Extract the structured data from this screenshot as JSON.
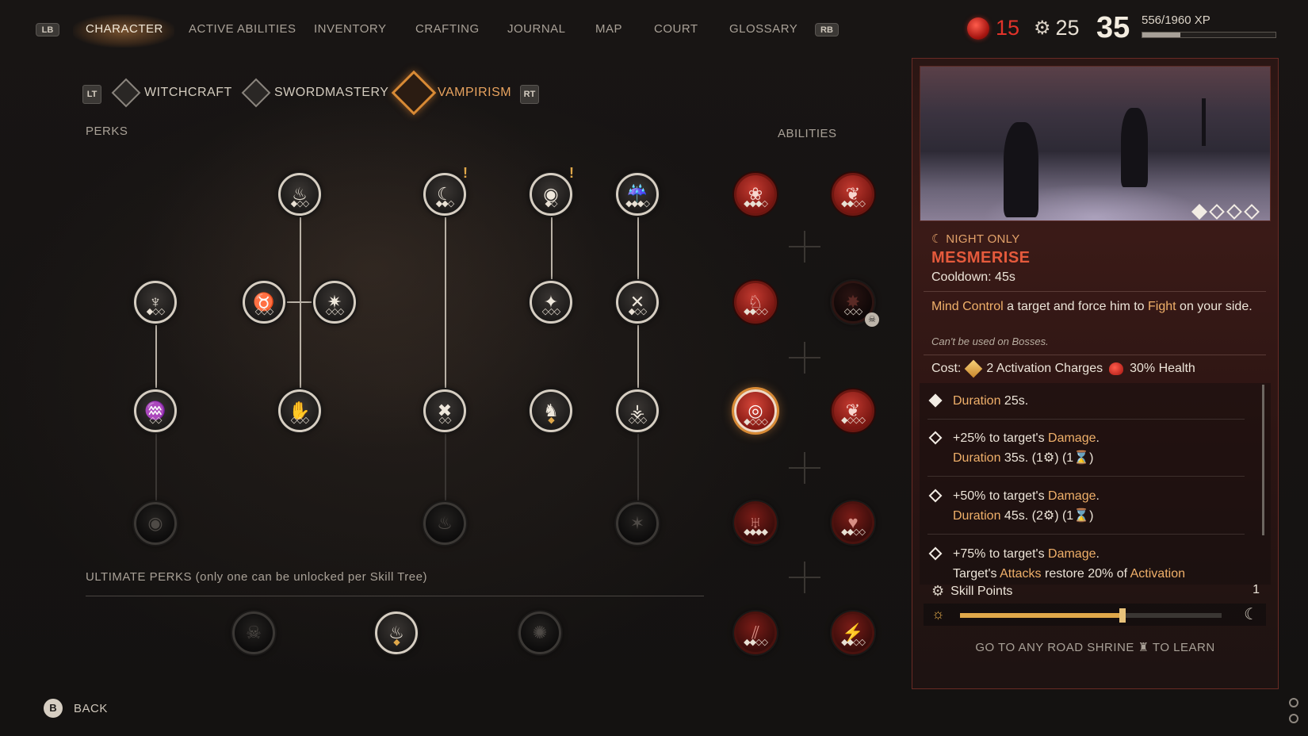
{
  "topbar": {
    "lb": "LB",
    "rb": "RB",
    "tabs": [
      {
        "label": "CHARACTER",
        "active": true
      },
      {
        "label": "ACTIVE ABILITIES"
      },
      {
        "label": "INVENTORY"
      },
      {
        "label": "CRAFTING"
      },
      {
        "label": "JOURNAL"
      },
      {
        "label": "MAP"
      },
      {
        "label": "COURT"
      },
      {
        "label": "GLOSSARY"
      }
    ],
    "blood": "15",
    "skill_points": "25",
    "level": "35",
    "xp_text": "556/1960 XP",
    "xp_progress": 0.284
  },
  "tree_tabs": {
    "lt": "LT",
    "rt": "RT",
    "items": [
      {
        "label": "WITCHCRAFT",
        "icon": "witchcraft-icon"
      },
      {
        "label": "SWORDMASTERY",
        "icon": "sword-icon"
      },
      {
        "label": "VAMPIRISM",
        "icon": "fangs-icon",
        "active": true
      }
    ]
  },
  "labels": {
    "perks": "PERKS",
    "abilities": "ABILITIES",
    "ultimate": "ULTIMATE PERKS (only one can be unlocked per Skill Tree)"
  },
  "panel": {
    "night_only": "☾ NIGHT ONLY",
    "name": "MESMERISE",
    "cooldown": "Cooldown: 45s",
    "desc_parts": [
      "Mind Control",
      " a target and force him to ",
      "Fight",
      " on your side."
    ],
    "note": "Can't be used on Bosses.",
    "cost_label": "Cost:",
    "cost_charges": "2 Activation Charges",
    "cost_health": "30% Health",
    "upgrades": [
      {
        "filled": true,
        "line1a": "Duration",
        "line1b": " 25s."
      },
      {
        "filled": false,
        "line1a": "+25% to target's ",
        "line1b": "Damage",
        "line1c": ".",
        "line2a": "Duration",
        "line2b": " 35s. (1⚙) (1⌛)"
      },
      {
        "filled": false,
        "line1a": "+50% to target's ",
        "line1b": "Damage",
        "line1c": ".",
        "line2a": "Duration",
        "line2b": " 45s. (2⚙) (1⌛)"
      },
      {
        "filled": false,
        "line1a": "+75% to target's ",
        "line1b": "Damage",
        "line1c": ".",
        "line2a": "Target's ",
        "line2b": "Attacks",
        "line2c": " restore 20% of ",
        "line2d": "Activation"
      }
    ],
    "skill_points_label": "Skill Points",
    "skill_points_value": "1",
    "day_night_progress": 0.62,
    "shrine_before": "GO TO ANY ROAD SHRINE",
    "shrine_after": "TO LEARN",
    "preview_level_pips": [
      true,
      false,
      false,
      false
    ]
  },
  "bottom": {
    "back_button": "B",
    "back_label": "BACK"
  },
  "colors": {
    "accent_gold": "#e0a84a",
    "ability_red": "#e55a3c",
    "blood_red": "#e2332a"
  }
}
